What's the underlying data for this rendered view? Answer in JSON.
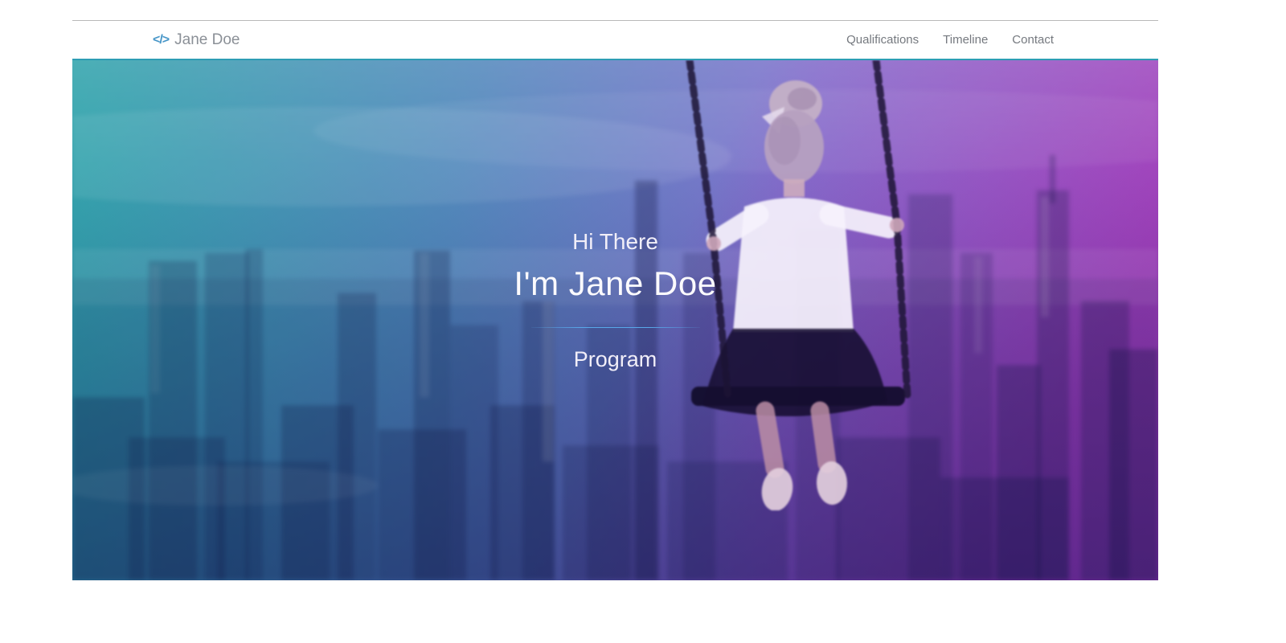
{
  "header": {
    "logo": {
      "icon": "</>",
      "text": "Jane Doe"
    },
    "nav": [
      {
        "label": "Qualifications"
      },
      {
        "label": "Timeline"
      },
      {
        "label": "Contact"
      }
    ]
  },
  "hero": {
    "greeting": "Hi There",
    "title": "I'm Jane Doe",
    "subtitle": "Program"
  },
  "colors": {
    "logo_icon": "#4796c8",
    "nav_text": "#75797f",
    "hero_text": "#f4f1fa",
    "divider_blue": "#58a8ea",
    "hero_top_border": "#2e9db4",
    "gradient_top_left": "#43a4ac",
    "gradient_top_right": "#a98fd6",
    "gradient_bottom_left": "#31508d",
    "gradient_bottom_right": "#6c1d94"
  }
}
